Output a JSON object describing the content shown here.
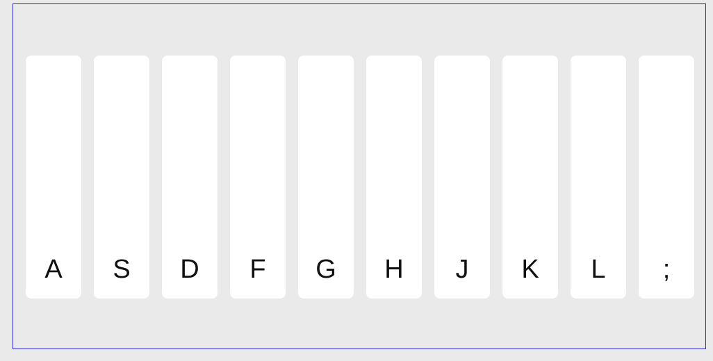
{
  "keyboard": {
    "keys": [
      {
        "label": "A"
      },
      {
        "label": "S"
      },
      {
        "label": "D"
      },
      {
        "label": "F"
      },
      {
        "label": "G"
      },
      {
        "label": "H"
      },
      {
        "label": "J"
      },
      {
        "label": "K"
      },
      {
        "label": "L"
      },
      {
        "label": ";"
      }
    ]
  },
  "colors": {
    "background": "#eaeaea",
    "key": "#ffffff",
    "border": "#2b2bd0",
    "text": "#111111"
  }
}
